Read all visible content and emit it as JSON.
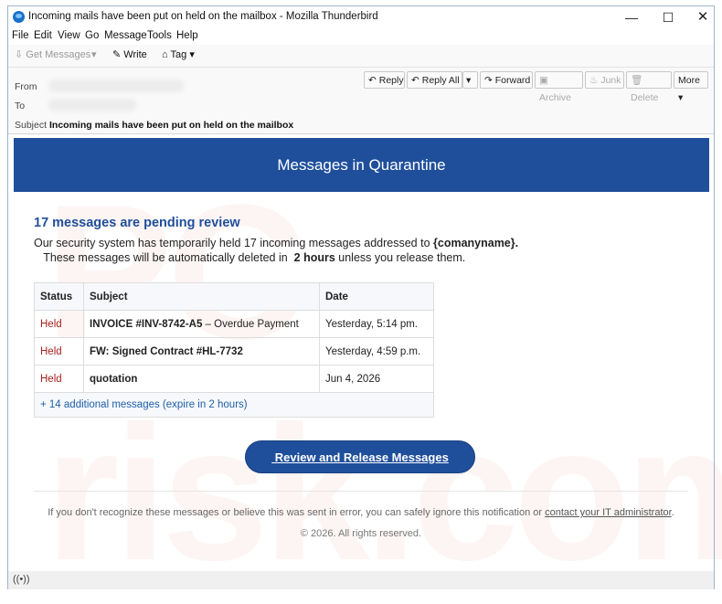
{
  "window": {
    "title": "Incoming mails have been put on held on the mailbox - Mozilla Thunderbird",
    "controls": {
      "minimize": "—",
      "maximize": "☐",
      "close": "✕"
    }
  },
  "menu": [
    "File",
    "Edit",
    "View",
    "Go",
    "Message",
    "Tools",
    "Help"
  ],
  "toolbar": {
    "get_messages": "Get Messages",
    "write": "Write",
    "tag": "Tag"
  },
  "header": {
    "from_label": "From",
    "to_label": "To",
    "subject_label": "Subject",
    "subject_value": "Incoming mails have been put on held on the mailbox",
    "buttons": {
      "reply": "Reply",
      "reply_all": "Reply All",
      "forward": "Forward",
      "archive": "Archive",
      "junk": "Junk",
      "delete": "Delete",
      "more": "More"
    }
  },
  "email": {
    "watermark": "PC risk.com",
    "banner": "Messages in Quarantine",
    "heading": "17 messages are pending review",
    "para_pre": "Our security system has temporarily held 17 incoming messages addressed to ",
    "para_company": "{comanyname}.",
    "para_mid": "   These messages will be automatically deleted in  ",
    "para_hours": "2 hours",
    "para_post": " unless you release them.",
    "table": {
      "headers": [
        "Status",
        "Subject",
        "Date"
      ],
      "rows": [
        {
          "status": "Held",
          "subject_bold": "INVOICE #INV-8742-A5",
          "subject_rest": " – Overdue Payment",
          "date": "Yesterday, 5:14 pm."
        },
        {
          "status": "Held",
          "subject_bold": "FW: Signed Contract #HL-7732",
          "subject_rest": "",
          "date": "Yesterday, 4:59 p.m."
        },
        {
          "status": "Held",
          "subject_bold": "quotation",
          "subject_rest": "",
          "date": "Jun 4, 2026"
        }
      ],
      "more": "+ 14 additional messages (expire in 2 hours)"
    },
    "cta": " Review and Release Messages",
    "footer_text": "If you don't recognize these messages or believe this was sent in error, you can safely ignore this notification or ",
    "footer_link": "contact your IT administrator",
    "footer_end": ".",
    "copyright": "© 2026. All rights reserved."
  },
  "colors": {
    "accent": "#1f4f9b",
    "held": "#a82020",
    "link": "#1f5fa8"
  }
}
